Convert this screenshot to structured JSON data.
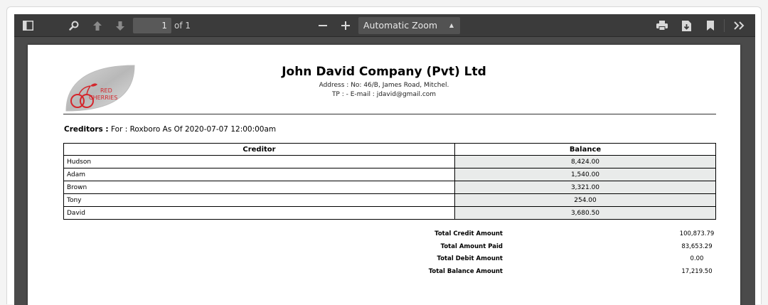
{
  "toolbar": {
    "page_number": "1",
    "page_count_label": "of 1",
    "zoom_value": "Automatic Zoom",
    "icons": [
      "sidebar-toggle-icon",
      "search-icon",
      "previous-page-icon",
      "next-page-icon",
      "zoom-out-icon",
      "zoom-in-icon",
      "print-icon",
      "download-icon",
      "bookmark-icon",
      "tools-icon"
    ]
  },
  "document": {
    "logo_text": {
      "line1": "RED",
      "line2": "CHERRIES"
    },
    "company_name": "John David Company (Pvt) Ltd",
    "address": "Address : No: 46/B, James Road, Mitchel.",
    "contact": "TP :  - E-mail : jdavid@gmail.com",
    "caption_label": "Creditors :",
    "caption_text": "For : Roxboro As Of 2020-07-07 12:00:00am",
    "table": {
      "headers": [
        "Creditor",
        "Balance"
      ],
      "rows": [
        [
          "Hudson",
          "8,424.00"
        ],
        [
          "Adam",
          "1,540.00"
        ],
        [
          "Brown",
          "3,321.00"
        ],
        [
          "Tony",
          "254.00"
        ],
        [
          "David",
          "3,680.50"
        ]
      ]
    },
    "totals": [
      {
        "label": "Total Credit Amount",
        "value": "100,873.79"
      },
      {
        "label": "Total Amount Paid",
        "value": "83,653.29"
      },
      {
        "label": "Total Debit Amount",
        "value": "0.00"
      },
      {
        "label": "Total Balance Amount",
        "value": "17,219.50"
      }
    ]
  }
}
